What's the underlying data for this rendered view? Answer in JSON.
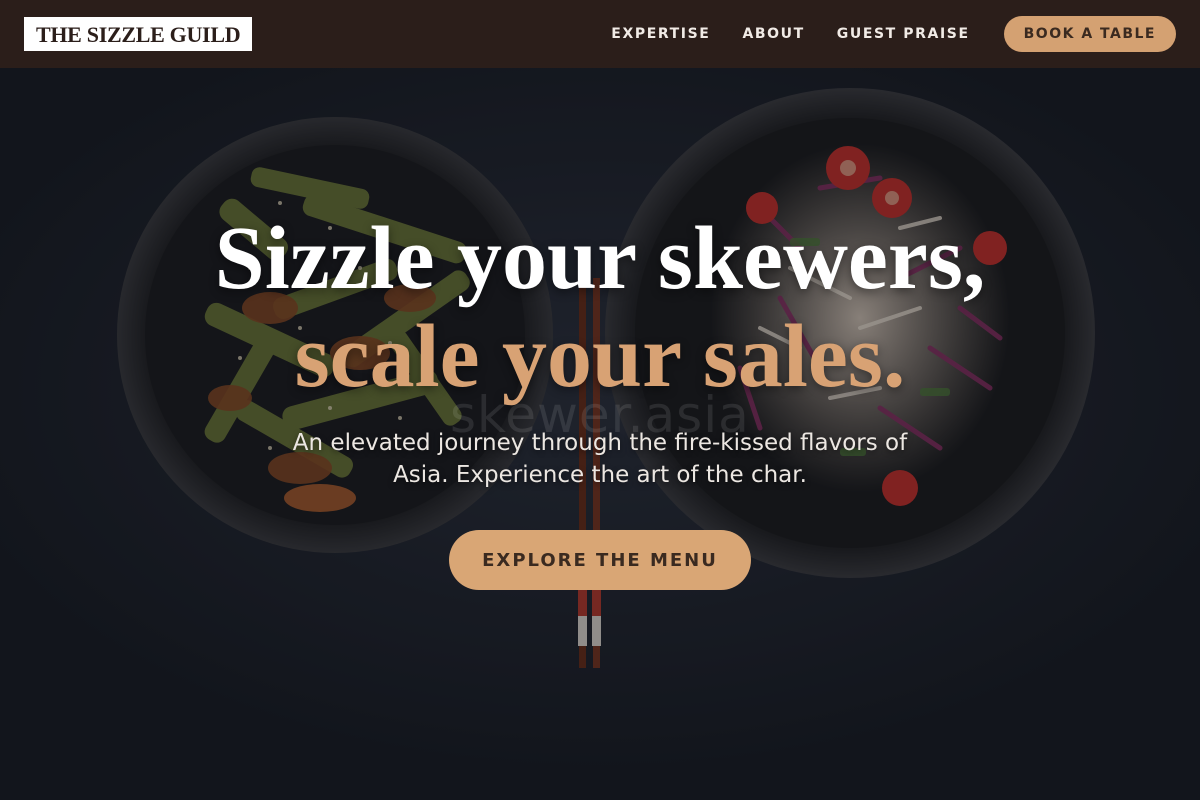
{
  "nav": {
    "logo_text": "THE SIZZLE GUILD",
    "links": [
      "EXPERTISE",
      "ABOUT",
      "GUEST PRAISE"
    ],
    "cta_label": "BOOK A TABLE"
  },
  "hero": {
    "headline_line1": "Sizzle your skewers,",
    "headline_line2": "scale your sales.",
    "watermark": "skewer.asia",
    "subtitle_line1": "An elevated journey through the fire-kissed flavors of",
    "subtitle_line2": "Asia. Experience the art of the char.",
    "cta_label": "EXPLORE THE MENU"
  },
  "colors": {
    "nav_bg": "#2b1e1a",
    "accent": "#d9a675",
    "headline_accent": "#d8a274",
    "hero_bg": "#20242e"
  }
}
